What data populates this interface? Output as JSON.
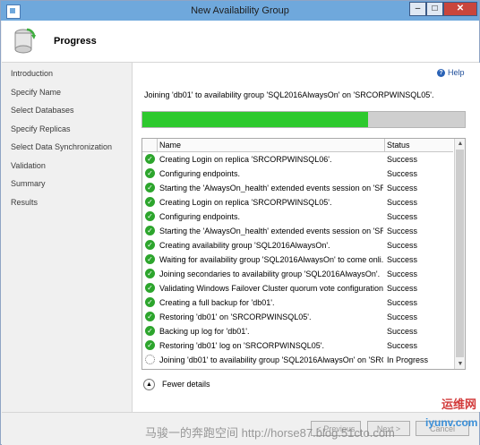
{
  "window": {
    "title": "New Availability Group"
  },
  "titlebar": {
    "min": "–",
    "max": "□",
    "close": "✕"
  },
  "header": {
    "page_title": "Progress"
  },
  "sidebar": {
    "items": [
      {
        "label": "Introduction"
      },
      {
        "label": "Specify Name"
      },
      {
        "label": "Select Databases"
      },
      {
        "label": "Specify Replicas"
      },
      {
        "label": "Select Data Synchronization"
      },
      {
        "label": "Validation"
      },
      {
        "label": "Summary"
      },
      {
        "label": "Results"
      }
    ]
  },
  "help": {
    "label": "Help",
    "icon": "?"
  },
  "status_message": "Joining 'db01' to availability group 'SQL2016AlwaysOn' on 'SRCORPWINSQL05'.",
  "progress": {
    "fraction": 0.7
  },
  "grid": {
    "columns": {
      "name": "Name",
      "status": "Status"
    },
    "rows": [
      {
        "name": "Creating Login on replica 'SRCORPWINSQL06'.",
        "status": "Success",
        "state": "done"
      },
      {
        "name": "Configuring endpoints.",
        "status": "Success",
        "state": "done"
      },
      {
        "name": "Starting the 'AlwaysOn_health' extended events session on 'SR...",
        "status": "Success",
        "state": "done"
      },
      {
        "name": "Creating Login on replica 'SRCORPWINSQL05'.",
        "status": "Success",
        "state": "done"
      },
      {
        "name": "Configuring endpoints.",
        "status": "Success",
        "state": "done"
      },
      {
        "name": "Starting the 'AlwaysOn_health' extended events session on 'SR...",
        "status": "Success",
        "state": "done"
      },
      {
        "name": "Creating availability group 'SQL2016AlwaysOn'.",
        "status": "Success",
        "state": "done"
      },
      {
        "name": "Waiting for availability group 'SQL2016AlwaysOn' to come onli...",
        "status": "Success",
        "state": "done"
      },
      {
        "name": "Joining secondaries to availability group 'SQL2016AlwaysOn'.",
        "status": "Success",
        "state": "done"
      },
      {
        "name": "Validating Windows Failover Cluster quorum vote configuration",
        "status": "Success",
        "state": "done"
      },
      {
        "name": "Creating a full backup for 'db01'.",
        "status": "Success",
        "state": "done"
      },
      {
        "name": "Restoring 'db01' on 'SRCORPWINSQL05'.",
        "status": "Success",
        "state": "done"
      },
      {
        "name": "Backing up log for 'db01'.",
        "status": "Success",
        "state": "done"
      },
      {
        "name": "Restoring 'db01' log on 'SRCORPWINSQL05'.",
        "status": "Success",
        "state": "done"
      },
      {
        "name": "Joining 'db01' to availability group 'SQL2016AlwaysOn' on 'SRC...",
        "status": "In Progress",
        "state": "running"
      }
    ]
  },
  "fewer_details": {
    "label": "Fewer details",
    "icon": "▲"
  },
  "footer": {
    "previous": "< Previous",
    "next": "Next >",
    "cancel": "Cancel",
    "watermark": "马骏一的奔跑空间 http://horse87.blog.51cto.com"
  },
  "logo": {
    "top": "运维网",
    "bottom": "iyunv.com"
  },
  "colors": {
    "progress_fill": "#2dc92d",
    "success_icon": "#2da52d",
    "titlebar": "#6fa8dc"
  }
}
